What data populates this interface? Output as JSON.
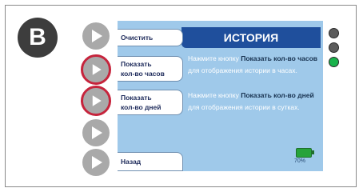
{
  "badge": "B",
  "screen": {
    "title": "ИСТОРИЯ",
    "soft_keys": [
      {
        "label": "Очистить"
      },
      {
        "label": "Показать\nкол-во часов"
      },
      {
        "label": "Показать\nкол-во дней"
      },
      {
        "label": ""
      },
      {
        "label": "Назад"
      }
    ],
    "paragraph1": {
      "prefix": "Нажмите кнопку ",
      "bold": "Показать кол-во часов",
      "suffix": " для отображения истории в часах."
    },
    "paragraph2": {
      "prefix": "Нажмите кнопку ",
      "bold": "Показать кол-во дней",
      "suffix": " для отображения истории в сутках."
    },
    "battery_percent": "70%"
  },
  "buttons": [
    {
      "icon": "play-icon",
      "selected": false
    },
    {
      "icon": "play-icon",
      "selected": true
    },
    {
      "icon": "play-icon",
      "selected": true
    },
    {
      "icon": "play-icon",
      "selected": false
    },
    {
      "icon": "play-icon",
      "selected": false
    }
  ],
  "leds": [
    {
      "color": "#5c5c5c"
    },
    {
      "color": "#5c5c5c"
    },
    {
      "color": "#19b24b"
    }
  ]
}
